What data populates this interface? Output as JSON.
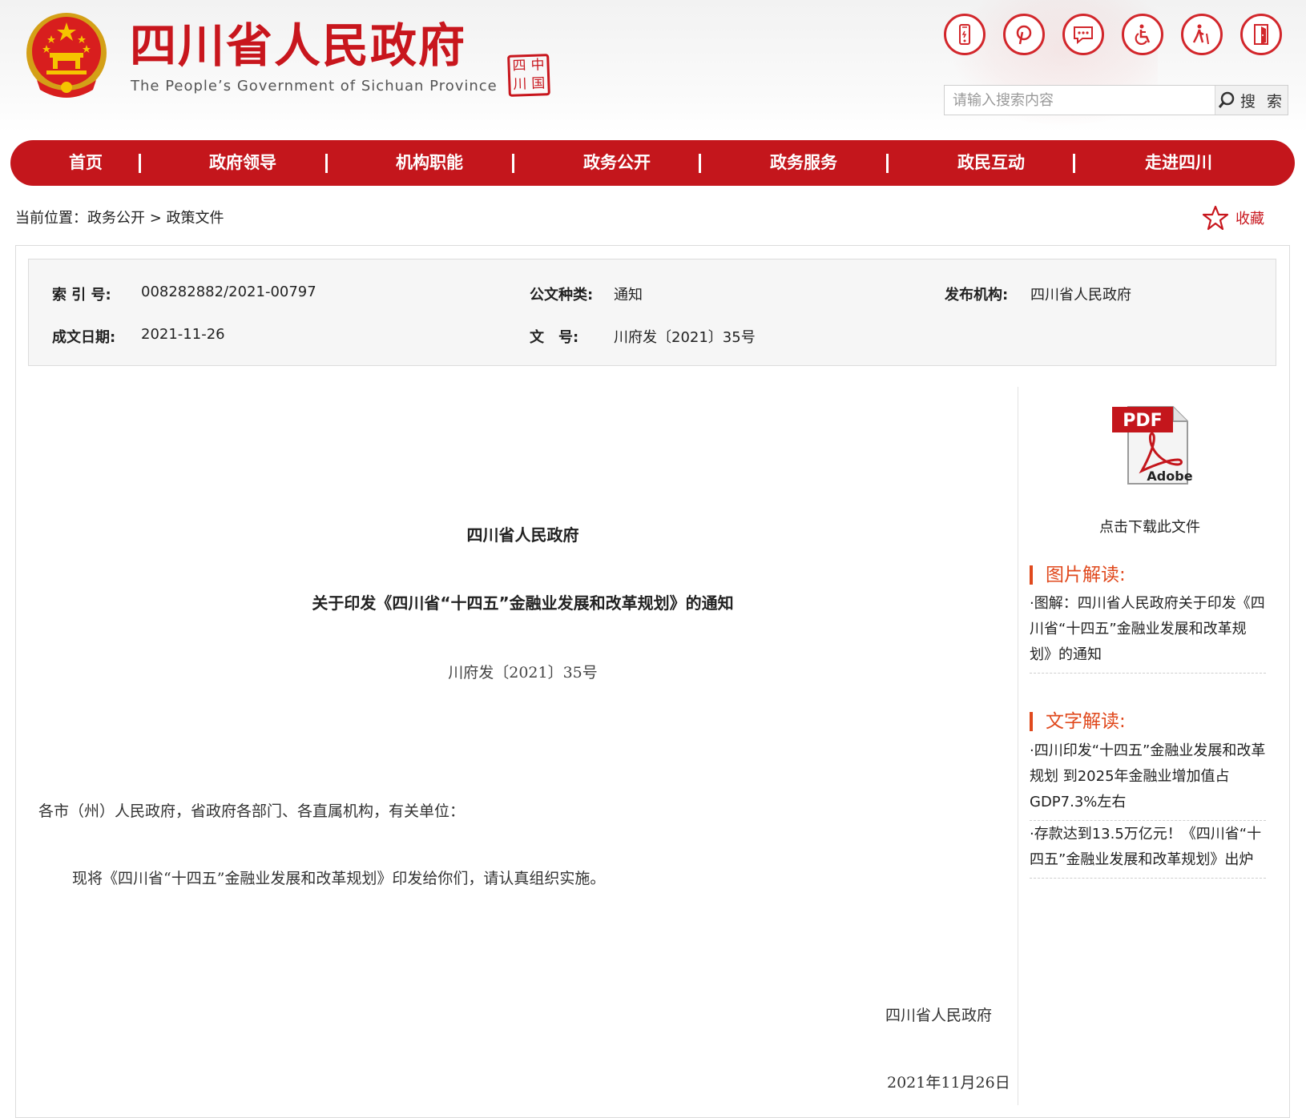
{
  "header": {
    "title": "四川省人民政府",
    "subtitle": "The People’s Government of Sichuan Province",
    "seal_text": [
      "中",
      "国",
      "四",
      "川"
    ],
    "tool_icons": [
      "mobile-icon",
      "weibo-icon",
      "message-icon",
      "accessibility-icon",
      "elderly-icon",
      "door-exit-icon"
    ],
    "search": {
      "placeholder": "请输入搜索内容",
      "button_label": "搜 索"
    }
  },
  "nav": {
    "items": [
      "首页",
      "政府领导",
      "机构职能",
      "政务公开",
      "政务服务",
      "政民互动",
      "走进四川"
    ]
  },
  "breadcrumb": {
    "text": "当前位置：政务公开 > 政策文件"
  },
  "favorite": {
    "label": "收藏"
  },
  "meta": {
    "index_label": "索 引 号:",
    "index_value": "008282882/2021-00797",
    "type_label": "公文种类:",
    "type_value": "通知",
    "publisher_label": "发布机构:",
    "publisher_value": "四川省人民政府",
    "date_label": "成文日期:",
    "date_value": "2021-11-26",
    "number_label": "文　号:",
    "number_value": "川府发〔2021〕35号"
  },
  "document": {
    "issuer": "四川省人民政府",
    "title": "关于印发《四川省“十四五”金融业发展和改革规划》的通知",
    "number": "川府发〔2021〕35号",
    "salutation": "各市（州）人民政府，省政府各部门、各直属机构，有关单位：",
    "body": "现将《四川省“十四五”金融业发展和改革规划》印发给你们，请认真组织实施。",
    "signature": "四川省人民政府",
    "date": "2021年11月26日"
  },
  "sidebar": {
    "pdf_badge": "PDF",
    "pdf_brand": "Adobe",
    "download_label": "点击下载此文件",
    "image_section_title": "图片解读:",
    "image_links": [
      "·图解：四川省人民政府关于印发《四川省“十四五”金融业发展和改革规划》的通知"
    ],
    "text_section_title": "文字解读:",
    "text_links": [
      "·四川印发“十四五”金融业发展和改革规划 到2025年金融业增加值占GDP7.3%左右",
      "·存款达到13.5万亿元！《四川省“十四五”金融业发展和改革规划》出炉"
    ]
  },
  "colors": {
    "brand_red": "#c4161c",
    "section_orange": "#e0491d",
    "meta_bg": "#f6f6f6"
  }
}
